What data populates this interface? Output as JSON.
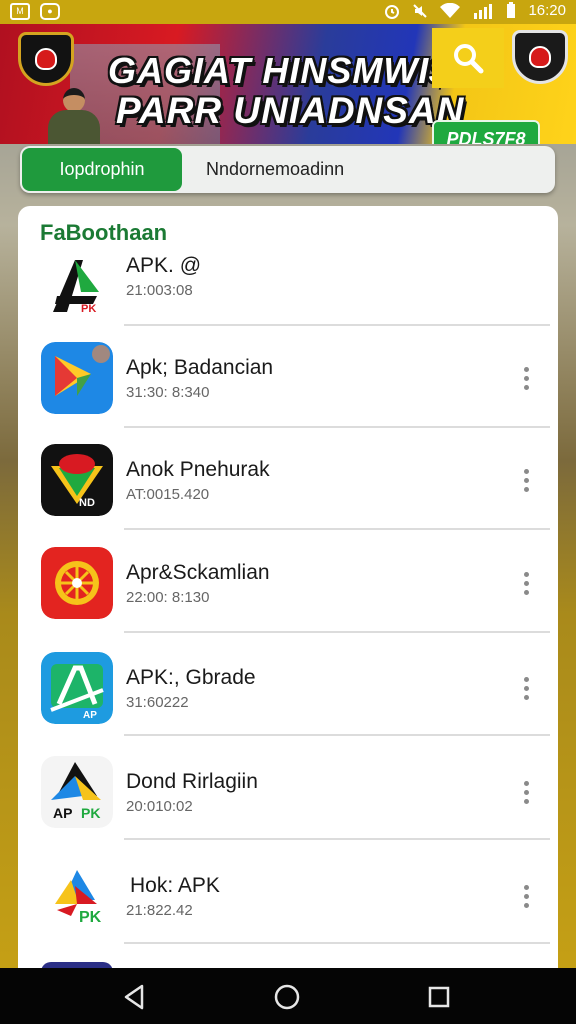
{
  "status_bar": {
    "left_icons": [
      "notification-icon",
      "app-notification-icon"
    ],
    "right_icons": [
      "alarm-icon",
      "mute-icon",
      "wifi-icon",
      "signal-icon",
      "battery-icon"
    ],
    "time": "16:20"
  },
  "banner": {
    "title_line1": "GAGIAT HINSMWI$!",
    "title_line2": "PARR UNIADNSAN",
    "badge": "PDLS7F8",
    "colors": {
      "red": "#d81a22",
      "blue": "#2236b8",
      "yellow": "#ffd31a",
      "green": "#1fa93f"
    }
  },
  "tabs": [
    {
      "label": "Iopdrophin",
      "active": true
    },
    {
      "label": "Nndornemoadinn",
      "active": false
    }
  ],
  "section_title": "FaBoothaan",
  "apps": [
    {
      "name": "APK. @",
      "meta": "21:003:08",
      "icon": "apk-a-logo-icon",
      "has_menu": false
    },
    {
      "name": "Apk; Badancian",
      "meta": "31:30: 8:340",
      "icon": "play-arrow-app-icon",
      "has_menu": true
    },
    {
      "name": "Anok Pnehurak",
      "meta": "AT:0015.420",
      "icon": "emblem-app-icon",
      "has_menu": true
    },
    {
      "name": "Apr&Sckamlian",
      "meta": "22:00: 8:130",
      "icon": "wheel-app-icon",
      "has_menu": true
    },
    {
      "name": "APK:, Gbrade",
      "meta": "31:60222",
      "icon": "green-a-app-icon",
      "has_menu": true
    },
    {
      "name": "Dond Rirlagiin",
      "meta": "20:010:02",
      "icon": "apk-colored-a-icon",
      "has_menu": true
    },
    {
      "name": "Hok: APK",
      "meta": "21:822.42",
      "icon": "apk-colorful-logo-icon",
      "has_menu": true
    }
  ],
  "nav": [
    "back-icon",
    "home-icon",
    "recents-icon"
  ]
}
